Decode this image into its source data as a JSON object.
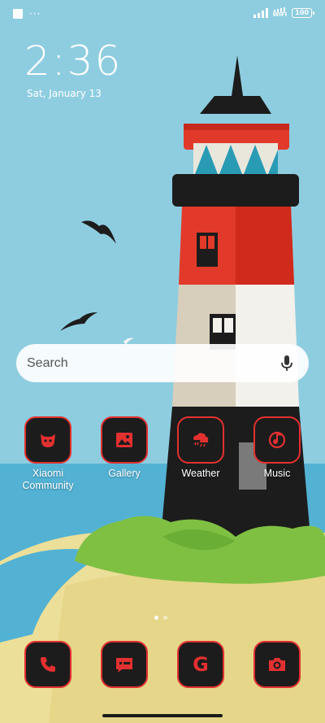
{
  "status_bar": {
    "dots": "···",
    "wifi_label": "WIFI",
    "battery_label": "100"
  },
  "clock": {
    "time": "2:36",
    "date": "Sat, January 13"
  },
  "search": {
    "placeholder": "Search"
  },
  "apps": [
    {
      "label": "Xiaomi Community",
      "icon": "xiaomi-community-icon"
    },
    {
      "label": "Gallery",
      "icon": "gallery-icon"
    },
    {
      "label": "Weather",
      "icon": "weather-icon"
    },
    {
      "label": "Music",
      "icon": "music-icon"
    }
  ],
  "dock": [
    {
      "icon": "phone-icon"
    },
    {
      "icon": "messages-icon"
    },
    {
      "icon": "google-icon"
    },
    {
      "icon": "camera-icon"
    }
  ],
  "dock_google_letter": "G",
  "colors": {
    "accent": "#e33030",
    "icon_bg": "#1c1c1c",
    "sky": "#8ecde0",
    "sand": "#ecdf99"
  }
}
